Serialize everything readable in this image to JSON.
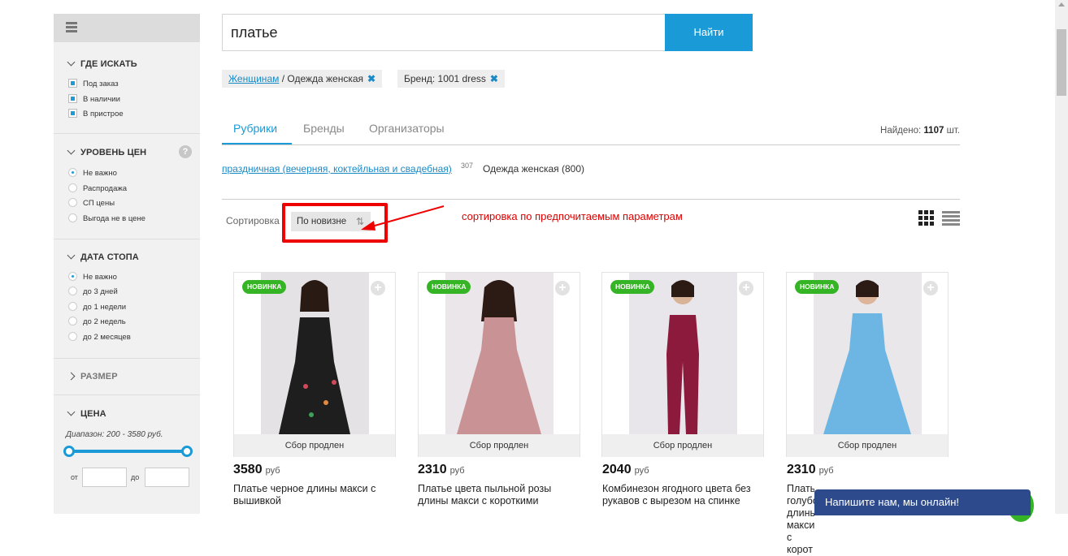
{
  "search": {
    "value": "платье",
    "button": "Найти"
  },
  "filters_applied": [
    {
      "link": "Женщинам",
      "rest": " / Одежда женская",
      "remove": "✖"
    },
    {
      "text": "Бренд: 1001 dress",
      "remove": "✖"
    }
  ],
  "tabs": [
    "Рубрики",
    "Бренды",
    "Организаторы"
  ],
  "found": {
    "label": "Найдено:",
    "count": "1107",
    "unit": "шт."
  },
  "rubrics": {
    "link": "праздничная (вечерняя, коктейльная и свадебная)",
    "count": "307",
    "second": "Одежда женская (800)"
  },
  "sort": {
    "label": "Сортировка",
    "value": "По новизне",
    "arrows": "⇅"
  },
  "annotation": "сортировка по предпочитаемым параметрам",
  "sidebar": {
    "where": {
      "title": "ГДЕ ИСКАТЬ",
      "options": [
        "Под заказ",
        "В наличии",
        "В пристрое"
      ]
    },
    "price_level": {
      "title": "УРОВЕНЬ ЦЕН",
      "help": "?",
      "options": [
        "Не важно",
        "Распродажа",
        "СП цены",
        "Выгода не в цене"
      ]
    },
    "stop_date": {
      "title": "ДАТА СТОПА",
      "options": [
        "Не важно",
        "до 3 дней",
        "до 1 недели",
        "до 2 недель",
        "до 2 месяцев"
      ]
    },
    "size": {
      "title": "РАЗМЕР"
    },
    "price": {
      "title": "ЦЕНА",
      "range": "Диапазон: 200 - 3580 руб.",
      "from": "от",
      "to": "до"
    }
  },
  "products": [
    {
      "badge": "НОВИНКА",
      "status": "Сбор продлен",
      "price": "3580",
      "currency": "руб",
      "title": "Платье черное длины макси с вышивкой",
      "color": "#1e1e1e"
    },
    {
      "badge": "НОВИНКА",
      "status": "Сбор продлен",
      "price": "2310",
      "currency": "руб",
      "title": "Платье цвета пыльной розы длины макси с короткими",
      "color": "#c99395"
    },
    {
      "badge": "НОВИНКА",
      "status": "Сбор продлен",
      "price": "2040",
      "currency": "руб",
      "title": "Комбинезон ягодного цвета без рукавов с вырезом на спинке",
      "color": "#8c1a3c"
    },
    {
      "badge": "НОВИНКА",
      "status": "Сбор продлен",
      "price": "2310",
      "currency": "руб",
      "title": "Платье голубое длины макси с корот",
      "color": "#6db6e4"
    }
  ],
  "chat": {
    "label": "Напишите нам, мы онлайн!"
  },
  "colors": {
    "accent": "#1a9ad6",
    "badge": "#35b525",
    "annotation": "#dd0000",
    "chat": "#2d4a8c"
  }
}
